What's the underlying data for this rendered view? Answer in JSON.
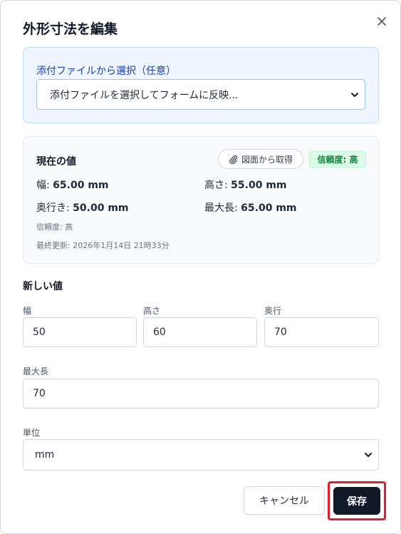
{
  "dialog": {
    "title": "外形寸法を編集",
    "close_icon": "close-icon"
  },
  "attachment": {
    "label": "添付ファイルから選択（任意）",
    "select_value": "添付ファイルを選択してフォームに反映..."
  },
  "current": {
    "title": "現在の値",
    "fetch_label": "図面から取得",
    "confidence_badge": "信頼度: 高",
    "width": {
      "label": "幅:",
      "value": "65.00 mm"
    },
    "height": {
      "label": "高さ:",
      "value": "55.00 mm"
    },
    "depth": {
      "label": "奥行き:",
      "value": "50.00 mm"
    },
    "max_length": {
      "label": "最大長:",
      "value": "65.00 mm"
    },
    "confidence_text": "信頼度: 高",
    "last_updated": "最終更新: 2026年1月14日 21時33分"
  },
  "new_values": {
    "title": "新しい値",
    "width": {
      "label": "幅",
      "value": "50"
    },
    "height": {
      "label": "高さ",
      "value": "60"
    },
    "depth": {
      "label": "奥行",
      "value": "70"
    },
    "max_length": {
      "label": "最大長",
      "value": "70"
    },
    "unit": {
      "label": "単位",
      "value": "mm"
    }
  },
  "actions": {
    "cancel": "キャンセル",
    "save": "保存"
  },
  "colors": {
    "primary_dark": "#111827",
    "highlight_red": "#e11d2a",
    "badge_green": "#15803d",
    "info_blue": "#1e40af"
  }
}
